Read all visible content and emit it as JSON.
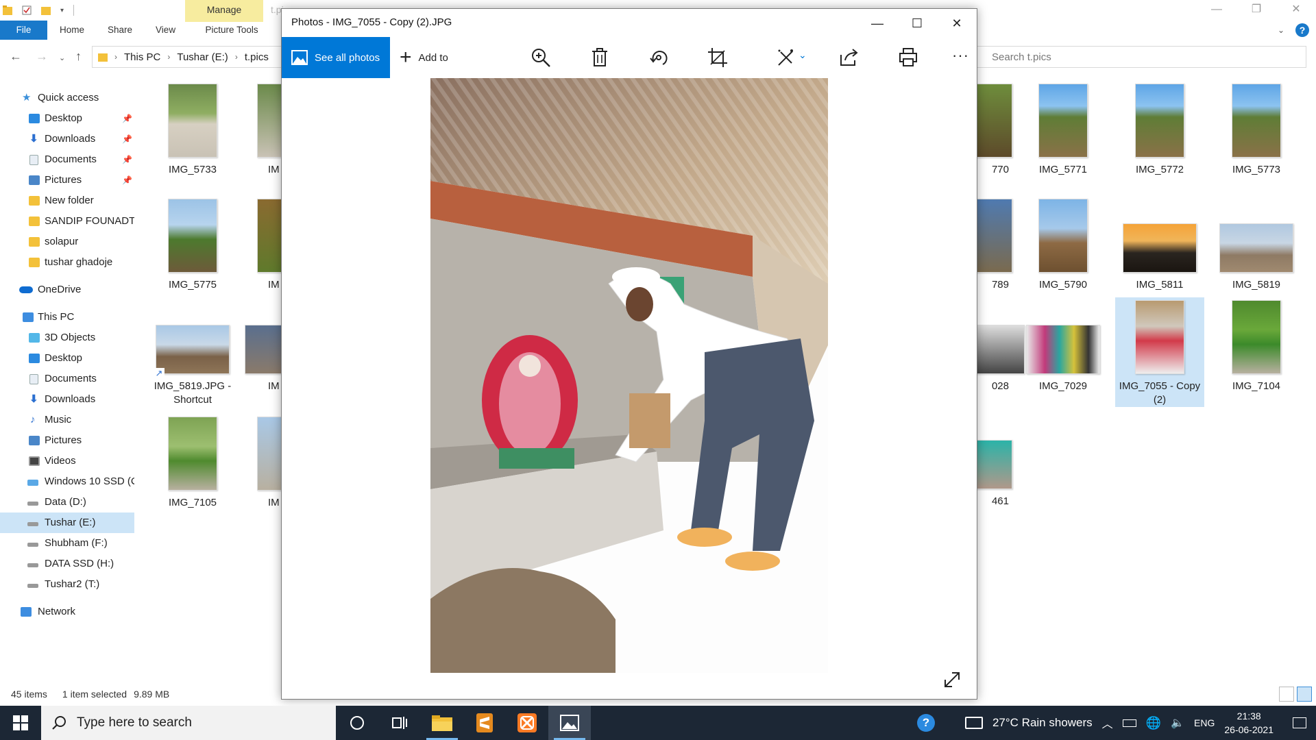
{
  "explorer": {
    "ribbon": {
      "context_tab": "Manage",
      "faded_title": "t.pi",
      "tabs": [
        "File",
        "Home",
        "Share",
        "View",
        "Picture Tools"
      ]
    },
    "address": {
      "crumbs": [
        "This PC",
        "Tushar (E:)",
        "t.pics"
      ]
    },
    "search": {
      "placeholder": "Search t.pics"
    },
    "nav": {
      "quick_access": "Quick access",
      "quick_items": [
        "Desktop",
        "Downloads",
        "Documents",
        "Pictures",
        "New folder",
        "SANDIP FOUNADTIO",
        "solapur",
        "tushar ghadoje"
      ],
      "onedrive": "OneDrive",
      "this_pc": "This PC",
      "pc_items": [
        "3D Objects",
        "Desktop",
        "Documents",
        "Downloads",
        "Music",
        "Pictures",
        "Videos",
        "Windows 10 SSD (C",
        "Data (D:)",
        "Tushar (E:)",
        "Shubham (F:)",
        "DATA SSD (H:)",
        "Tushar2 (T:)"
      ],
      "network": "Network"
    },
    "files": {
      "col1": [
        "IMG_5733",
        "IMG_5775",
        "IMG_5819.JPG - Shortcut",
        "IMG_7105"
      ],
      "col2": [
        "IM",
        "IM",
        "IM",
        "IM"
      ],
      "partial": [
        "770",
        "789",
        "028",
        "461"
      ],
      "right": [
        [
          "IMG_5771",
          "IMG_5772",
          "IMG_5773"
        ],
        [
          "IMG_5790",
          "IMG_5811",
          "IMG_5819"
        ],
        [
          "IMG_7029",
          "IMG_7055 - Copy (2)",
          "IMG_7104"
        ]
      ]
    },
    "status": {
      "items": "45 items",
      "selected": "1 item selected",
      "size": "9.89 MB"
    }
  },
  "photos": {
    "title": "Photos - IMG_7055 - Copy (2).JPG",
    "see_all": "See all photos",
    "add_to": "Add to",
    "tools": [
      "zoom-in-icon",
      "delete-icon",
      "rotate-icon",
      "crop-icon",
      "edit-icon",
      "share-icon",
      "print-icon",
      "more-icon"
    ]
  },
  "taskbar": {
    "search_placeholder": "Type here to search",
    "weather": "27°C  Rain showers",
    "lang": "ENG",
    "time": "21:38",
    "date": "26-06-2021"
  },
  "colors": {
    "accent": "#0078d7",
    "file_tab": "#1979ca",
    "manage_tab": "#f7ec9f",
    "taskbar": "#1c2735",
    "selection": "#cce4f7"
  }
}
